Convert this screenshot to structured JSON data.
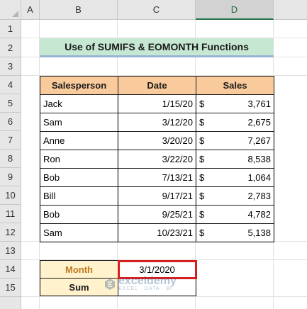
{
  "columns": [
    "A",
    "B",
    "C",
    "D"
  ],
  "rows": [
    "1",
    "2",
    "3",
    "4",
    "5",
    "6",
    "7",
    "8",
    "9",
    "10",
    "11",
    "12",
    "13",
    "14",
    "15"
  ],
  "title": "Use of SUMIFS & EOMONTH Functions",
  "table": {
    "headers": [
      "Salesperson",
      "Date",
      "Sales"
    ],
    "rows": [
      {
        "salesperson": "Jack",
        "date": "1/15/20",
        "currency": "$",
        "sales": "3,761"
      },
      {
        "salesperson": "Sam",
        "date": "3/12/20",
        "currency": "$",
        "sales": "2,675"
      },
      {
        "salesperson": "Anne",
        "date": "3/20/20",
        "currency": "$",
        "sales": "7,267"
      },
      {
        "salesperson": "Ron",
        "date": "3/22/20",
        "currency": "$",
        "sales": "8,538"
      },
      {
        "salesperson": "Bob",
        "date": "7/13/21",
        "currency": "$",
        "sales": "1,064"
      },
      {
        "salesperson": "Bill",
        "date": "9/17/21",
        "currency": "$",
        "sales": "2,783"
      },
      {
        "salesperson": "Bob",
        "date": "9/25/21",
        "currency": "$",
        "sales": "4,782"
      },
      {
        "salesperson": "Sam",
        "date": "10/23/21",
        "currency": "$",
        "sales": "5,138"
      }
    ]
  },
  "calc": {
    "month_label": "Month",
    "month_value": "3/1/2020",
    "sum_label": "Sum",
    "sum_value": ""
  },
  "watermark": {
    "name": "exceldemy",
    "tagline": "EXCEL · DATA · BI"
  },
  "colors": {
    "header_fill": "#f9cb9c",
    "title_fill": "#c6e7d2",
    "label_fill": "#fff2cc",
    "selection_border": "#d6201f"
  }
}
